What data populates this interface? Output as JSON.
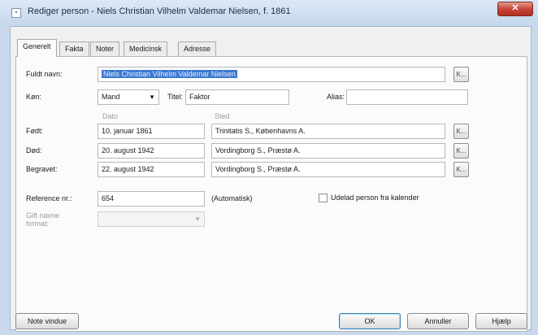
{
  "window": {
    "title": "Rediger person - Niels Christian Vilhelm Valdemar Nielsen, f. 1861",
    "close": "✕"
  },
  "tabs": [
    "Generelt",
    "Fakta",
    "Noter",
    "Medicinsk",
    "Adresse"
  ],
  "form": {
    "full_name_label": "Fuldt navn:",
    "full_name_value": "Niels Christian Vilhelm Valdemar Nielsen",
    "gender_label": "Køn:",
    "gender_value": "Mand",
    "title_label": "Titel:",
    "title_value": "Faktor",
    "alias_label": "Alias:",
    "alias_value": "",
    "date_header": "Dato",
    "place_header": "Sted",
    "born_label": "Født:",
    "born_date": "10. januar 1861",
    "born_place": "Trinitatis S., Københavns A.",
    "died_label": "Død:",
    "died_date": "20. august 1942",
    "died_place": "Vordingborg S., Præstø A.",
    "buried_label": "Begravet:",
    "buried_date": "22. august 1942",
    "buried_place": "Vordingborg S., Præstø A.",
    "k_button": "K...",
    "reference_label": "Reference nr.:",
    "reference_value": "654",
    "automatic_label": "(Automatisk)",
    "exclude_calendar_label": "Udelad person fra kalender",
    "married_name_label_1": "Gift navne",
    "married_name_label_2": "format:"
  },
  "footer": {
    "note_window": "Note vindue",
    "ok": "OK",
    "cancel": "Annuller",
    "help": "Hjælp"
  }
}
